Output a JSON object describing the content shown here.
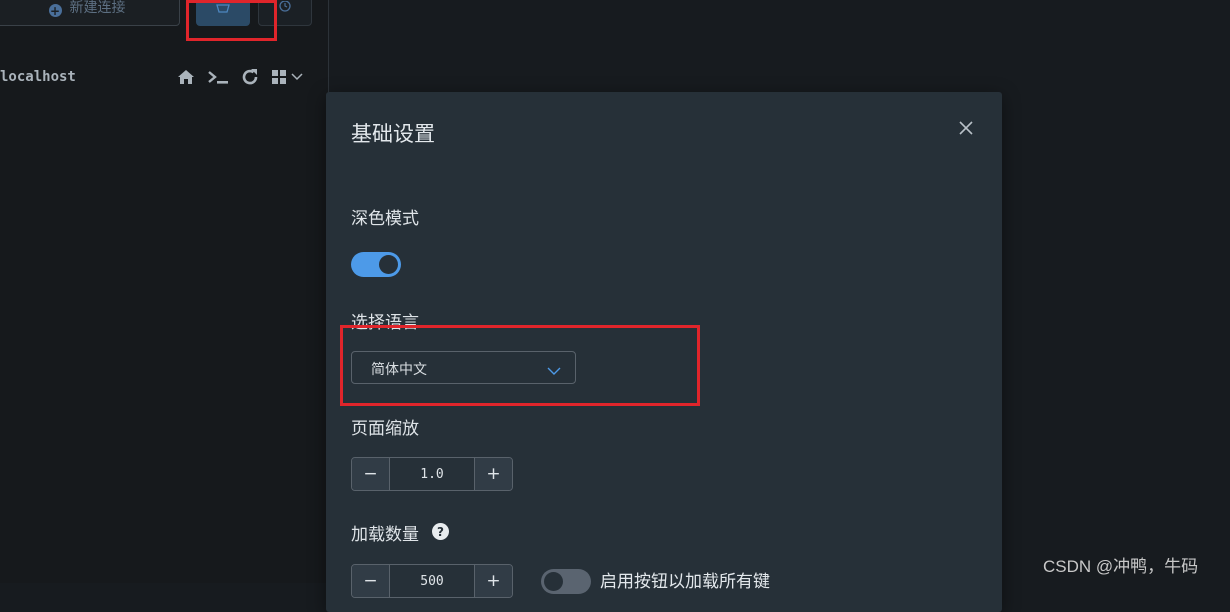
{
  "sidebar": {
    "new_connection_label": "新建连接",
    "connection_name": "localhost",
    "icons": [
      "home-icon",
      "terminal-icon",
      "refresh-icon",
      "grid-icon",
      "chevron-down-icon"
    ]
  },
  "dialog": {
    "title": "基础设置",
    "dark_mode_label": "深色模式",
    "dark_mode_on": true,
    "language_label": "选择语言",
    "language_value": "简体中文",
    "zoom_label": "页面缩放",
    "zoom_value": "1.0",
    "load_count_label": "加载数量",
    "load_count_value": "500",
    "load_all_label": "启用按钮以加载所有键",
    "load_all_on": false,
    "minus": "−",
    "plus": "+",
    "help": "?"
  },
  "watermark": "CSDN @冲鸭，牛码",
  "colors": {
    "accent": "#4d9ae8",
    "annotation": "#e0252b",
    "dialog_bg": "#263038"
  }
}
